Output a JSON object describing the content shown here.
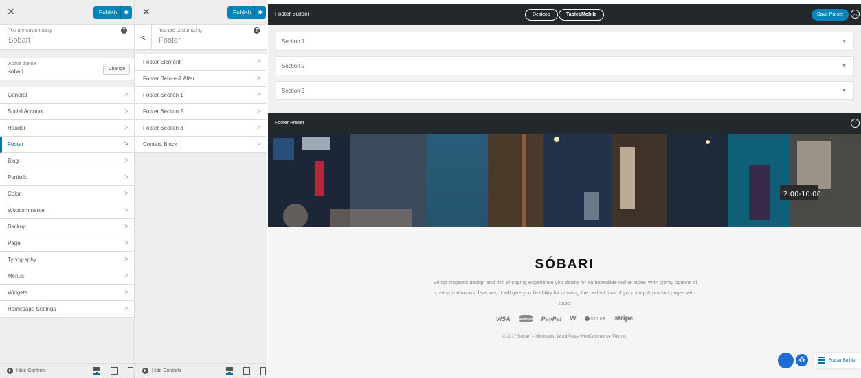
{
  "panel1": {
    "publish_label": "Publish",
    "customizing_label": "You are customizing",
    "customizing_title": "Sobari",
    "active_theme_label": "Active theme",
    "active_theme_name": "sobari",
    "change_label": "Change",
    "items": [
      {
        "label": "General"
      },
      {
        "label": "Social Account"
      },
      {
        "label": "Header"
      },
      {
        "label": "Footer"
      },
      {
        "label": "Blog"
      },
      {
        "label": "Portfolio"
      },
      {
        "label": "Color"
      },
      {
        "label": "Woocommerce"
      },
      {
        "label": "Backup"
      },
      {
        "label": "Page"
      },
      {
        "label": "Typography"
      },
      {
        "label": "Menus"
      },
      {
        "label": "Widgets"
      },
      {
        "label": "Homepage Settings"
      }
    ],
    "active_item": "Footer",
    "hide_controls": "Hide Controls"
  },
  "panel2": {
    "publish_label": "Publish",
    "customizing_label": "You are customizing",
    "customizing_title": "Footer",
    "items": [
      {
        "label": "Footer Element"
      },
      {
        "label": "Footer Before & After"
      },
      {
        "label": "Footer Section 1"
      },
      {
        "label": "Footer Section 2"
      },
      {
        "label": "Footer Section 3"
      },
      {
        "label": "Content Block"
      }
    ],
    "hide_controls": "Hide Controls"
  },
  "builder": {
    "title": "Footer Builder",
    "desktop_label": "Desktop",
    "tablet_label": "Tablet/Mobile",
    "save_preset_label": "Save Preset",
    "sections": [
      {
        "label": "Section 1"
      },
      {
        "label": "Section 2"
      },
      {
        "label": "Section 3"
      }
    ],
    "preset_title": "Footer Preset"
  },
  "preview": {
    "logo": "SÓBARI",
    "description": "Brings majestic design and rich shopping experience you desire for an incredible online store. With plenty options of customization and features, it will give you flexibility for creating the perfect look of your shop & product pages with ease.",
    "payments": {
      "visa": "VISA",
      "mastercard": "MasterCard",
      "paypal": "PayPal",
      "amex": "W",
      "other": "OTHER",
      "stripe": "stripe"
    },
    "copyright": "© 2017 Sobari – Minimalist WordPress WooCommerce Theme.",
    "footer_builder_chip": "Footer Builder"
  },
  "colors": {
    "accent": "#0085ba",
    "dark_bar": "#23282d",
    "fab_blue": "#1d6cd8"
  }
}
